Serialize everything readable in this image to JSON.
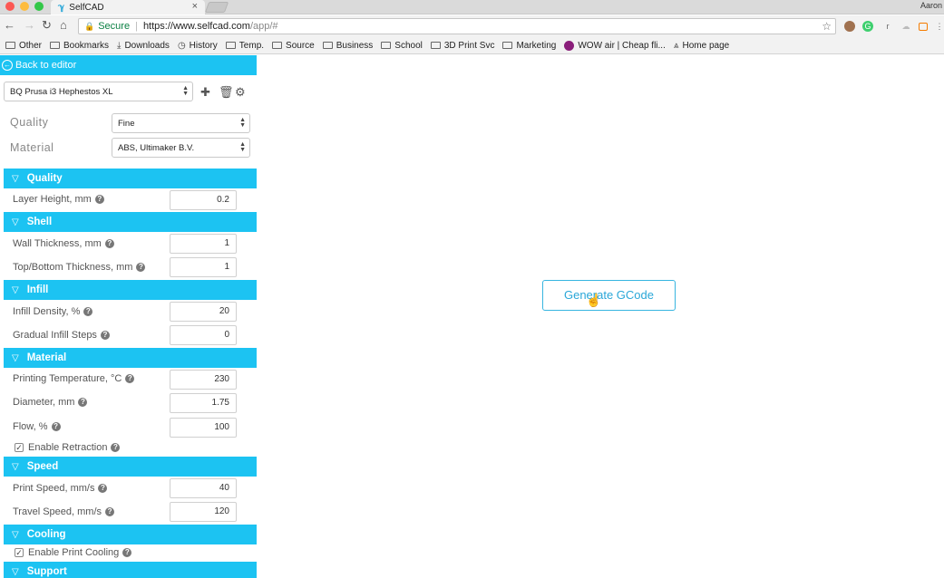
{
  "browser": {
    "tab_title": "SelfCAD",
    "tab_favicon": "selfcad-logo",
    "profile_name": "Aaron",
    "secure_label": "Secure",
    "url_main": "https://www.selfcad.com",
    "url_path": "/app/#",
    "bookmarks": [
      "Other",
      "Bookmarks",
      "Downloads",
      "History",
      "Temp.",
      "Source",
      "Business",
      "School",
      "3D Print Svc",
      "Marketing",
      "WOW air | Cheap fli...",
      "Home page"
    ]
  },
  "panel": {
    "back_label": "Back to editor",
    "printer_value": "BQ Prusa i3 Hephestos XL",
    "quality_label": "Quality",
    "quality_value": "Fine",
    "material_label": "Material",
    "material_value": "ABS, Ultimaker B.V.",
    "sections": {
      "quality": "Quality",
      "shell": "Shell",
      "infill": "Infill",
      "material": "Material",
      "speed": "Speed",
      "cooling": "Cooling",
      "support": "Support"
    },
    "fields": {
      "layer_height": {
        "label": "Layer Height, mm",
        "value": "0.2"
      },
      "wall_thickness": {
        "label": "Wall Thickness, mm",
        "value": "1"
      },
      "top_bottom_thickness": {
        "label": "Top/Bottom Thickness, mm",
        "value": "1"
      },
      "infill_density": {
        "label": "Infill Density, %",
        "value": "20"
      },
      "gradual_infill": {
        "label": "Gradual Infill Steps",
        "value": "0"
      },
      "print_temp": {
        "label": "Printing Temperature, °C",
        "value": "230"
      },
      "diameter": {
        "label": "Diameter, mm",
        "value": "1.75"
      },
      "flow": {
        "label": "Flow, %",
        "value": "100"
      },
      "print_speed": {
        "label": "Print Speed, mm/s",
        "value": "40"
      },
      "travel_speed": {
        "label": "Travel Speed, mm/s",
        "value": "120"
      }
    },
    "checks": {
      "enable_retraction": {
        "label": "Enable Retraction",
        "checked": true
      },
      "enable_print_cooling": {
        "label": "Enable Print Cooling",
        "checked": true
      }
    }
  },
  "main": {
    "generate_label": "Generate GCode"
  },
  "colors": {
    "accent": "#1cc3f2",
    "button_text": "#2aa7d8"
  }
}
